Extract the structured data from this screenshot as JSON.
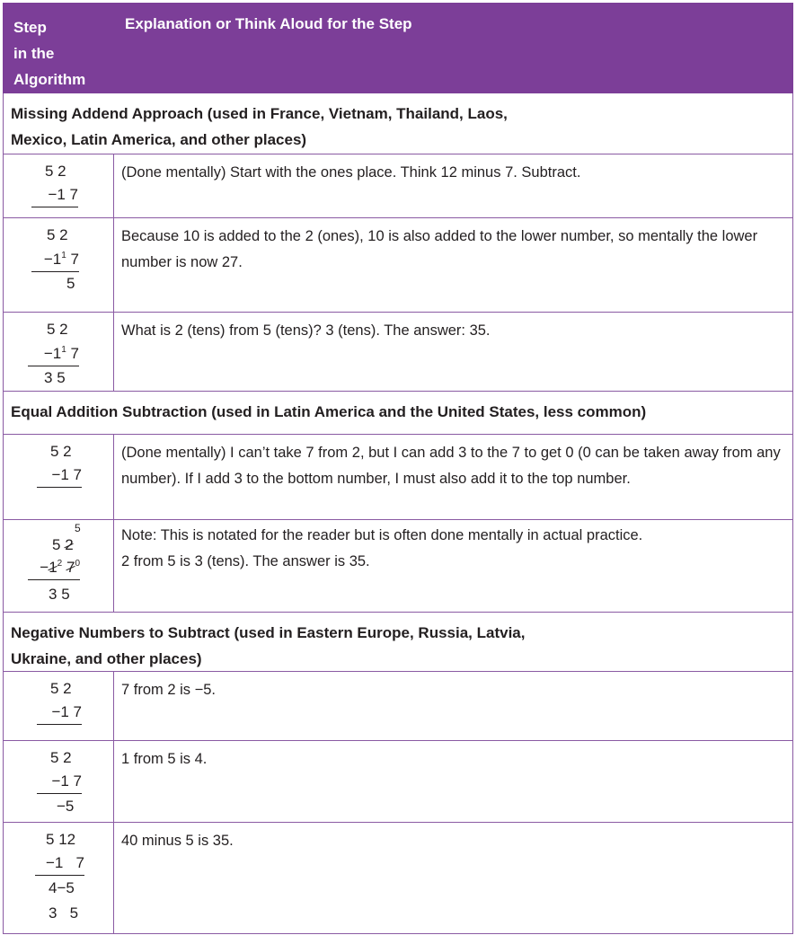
{
  "header": {
    "col1": [
      "Step",
      "in the",
      "Algorithm"
    ],
    "col2": "Explanation or Think Aloud for the Step"
  },
  "sections": {
    "missing_addend": {
      "title_line1": "Missing Addend Approach (used in France, Vietnam, Thailand, Laos,",
      "title_line2": "Mexico, Latin America, and other places)",
      "rows": [
        {
          "text": "(Done mentally) Start with the ones place. Think 12 minus 7. Subtract."
        },
        {
          "text": "Because 10 is added to the 2 (ones), 10 is also added to the lower number, so mentally the lower number is now 27."
        },
        {
          "text": "What is 2 (tens) from 5 (tens)? 3 (tens). The answer: 35."
        }
      ]
    },
    "equal_addition": {
      "title": "Equal Addition Subtraction (used in Latin America and the United States, less common)",
      "rows": [
        {
          "text": "(Done mentally) I can’t take 7 from 2, but I can add 3 to the 7 to get 0 (0 can be taken away from any number). If I add 3 to the bottom number, I must also add it to the top number."
        },
        {
          "text_line1": "Note: This is notated for the reader but is often done mentally in actual practice.",
          "text_line2": "2 from 5 is 3 (tens). The answer is 35."
        }
      ]
    },
    "negative_numbers": {
      "title_line1": "Negative Numbers to Subtract (used in Eastern Europe, Russia, Latvia,",
      "title_line2": "Ukraine, and other places)",
      "rows": [
        {
          "text": "7 from 2 is −5."
        },
        {
          "text": "1 from 5 is 4."
        },
        {
          "text": "40 minus 5 is 35."
        }
      ]
    }
  },
  "math": {
    "top": "5 2",
    "bottom": "−1 7",
    "minus": "−",
    "one": "1",
    "seven": "7",
    "five": "5",
    "two": "2",
    "three": "3",
    "four": "4",
    "twelve": "12",
    "zero": "0",
    "neg5": "−5",
    "four_minus_five": "4−5",
    "carry": "1",
    "carry2": "2"
  }
}
